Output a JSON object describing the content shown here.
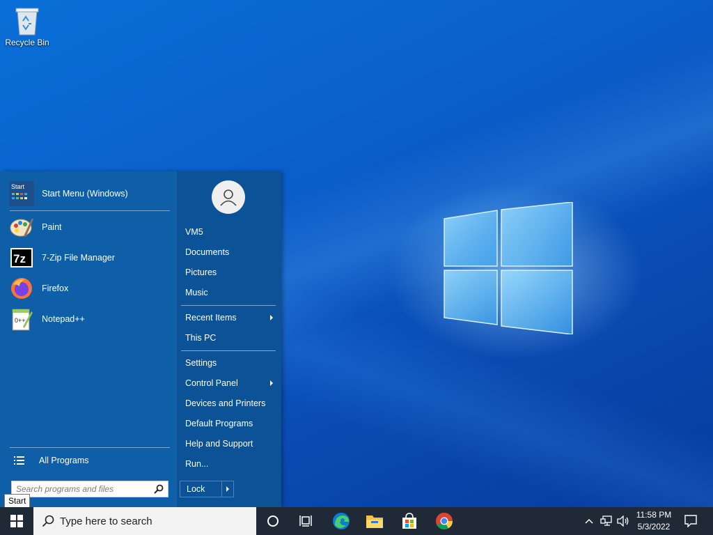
{
  "desktop": {
    "recycle_bin_label": "Recycle Bin"
  },
  "start_menu": {
    "pinned": [
      {
        "label": "Start Menu (Windows)",
        "icon": "start-menu-app-icon"
      },
      {
        "label": "Paint",
        "icon": "paint-icon"
      },
      {
        "label": "7-Zip File Manager",
        "icon": "7zip-icon"
      },
      {
        "label": "Firefox",
        "icon": "firefox-icon"
      },
      {
        "label": "Notepad++",
        "icon": "notepadpp-icon"
      }
    ],
    "start_icon_text": "Start",
    "sevenzip_icon_text": "7z",
    "notepad_icon_text": "0++",
    "all_programs": "All Programs",
    "search_placeholder": "Search programs and files",
    "right": {
      "user": "VM5",
      "group1": [
        "Documents",
        "Pictures",
        "Music"
      ],
      "group2": [
        "Recent Items",
        "This PC"
      ],
      "group3": [
        "Settings",
        "Control Panel",
        "Devices and Printers",
        "Default Programs",
        "Help and Support",
        "Run..."
      ],
      "lock": "Lock"
    },
    "tooltip": "Start"
  },
  "taskbar": {
    "search_placeholder": "Type here to search",
    "time": "11:58 PM",
    "date": "5/3/2022"
  },
  "colors": {
    "menu_bg": "#0f5fa8",
    "taskbar_bg": "#1f2a36",
    "accent": "#0a6fd8"
  }
}
